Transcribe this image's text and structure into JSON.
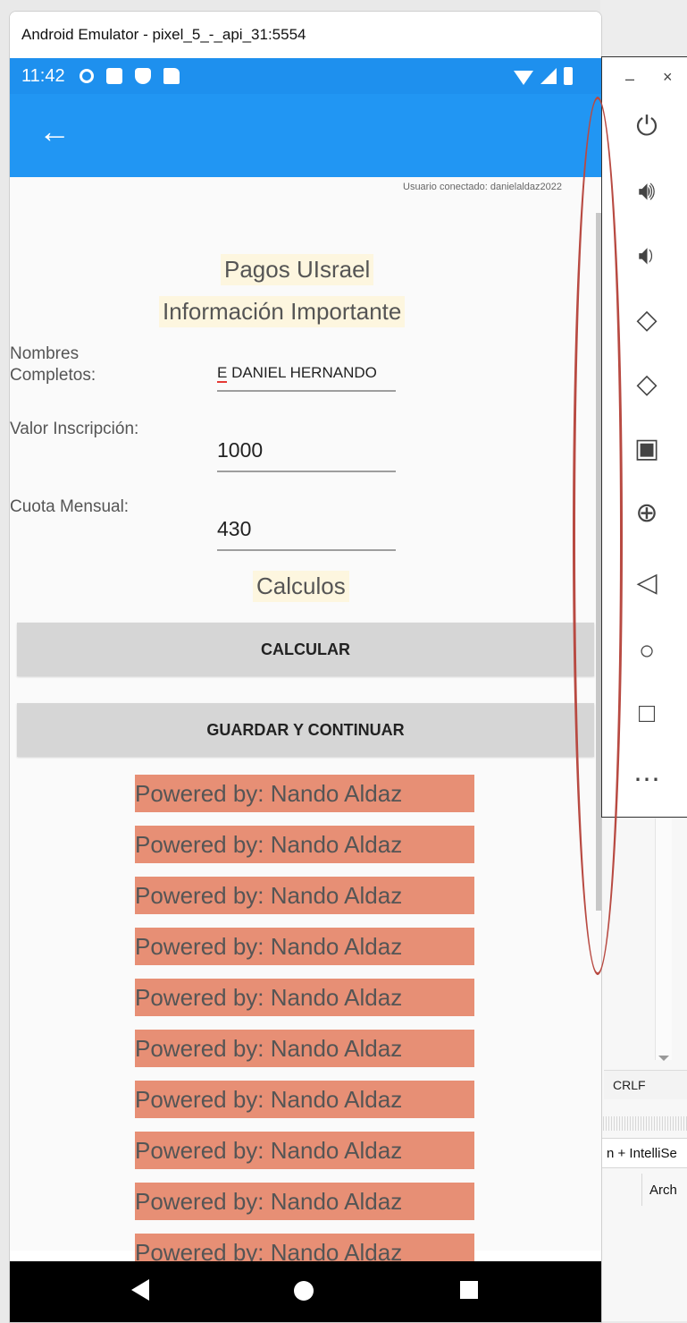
{
  "window": {
    "title": "Android Emulator - pixel_5_-_api_31:5554"
  },
  "status_bar": {
    "time": "11:42"
  },
  "app": {
    "connected_user": "Usuario conectado: danielaldaz2022",
    "title": "Pagos UIsrael",
    "subtitle": "Información Importante",
    "form": {
      "name_label": "Nombres Completos:",
      "name_prefix": "E",
      "name_value": " DANIEL HERNANDO",
      "inscription_label": "Valor Inscripción:",
      "inscription_value": "1000",
      "monthly_label": "Cuota Mensual:",
      "monthly_value": "430"
    },
    "calc_heading": "Calculos",
    "calculate_button": "CALCULAR",
    "save_button": "GUARDAR Y CONTINUAR",
    "powered_by": [
      "Powered by: Nando Aldaz",
      "Powered by: Nando Aldaz",
      "Powered by: Nando Aldaz",
      "Powered by: Nando Aldaz",
      "Powered by: Nando Aldaz",
      "Powered by: Nando Aldaz",
      "Powered by: Nando Aldaz",
      "Powered by: Nando Aldaz",
      "Powered by: Nando Aldaz",
      "Powered by: Nando Aldaz"
    ]
  },
  "emulator_toolbar": {
    "minimize": "–",
    "close": "×",
    "icons": [
      "power-icon",
      "volume-up-icon",
      "volume-down-icon",
      "rotate-left-icon",
      "rotate-right-icon",
      "camera-icon",
      "zoom-icon",
      "back-icon",
      "home-icon",
      "overview-icon",
      "more-icon"
    ]
  },
  "ide": {
    "line_ending": "CRLF",
    "intellisense": "n + IntelliSe",
    "archive": "Arch"
  },
  "colors": {
    "appbar": "#2196f3",
    "statusbar": "#1e90ee",
    "powered_bg": "#e78f75",
    "heading_bg": "#fdf6df",
    "annotation": "#b84a42"
  }
}
